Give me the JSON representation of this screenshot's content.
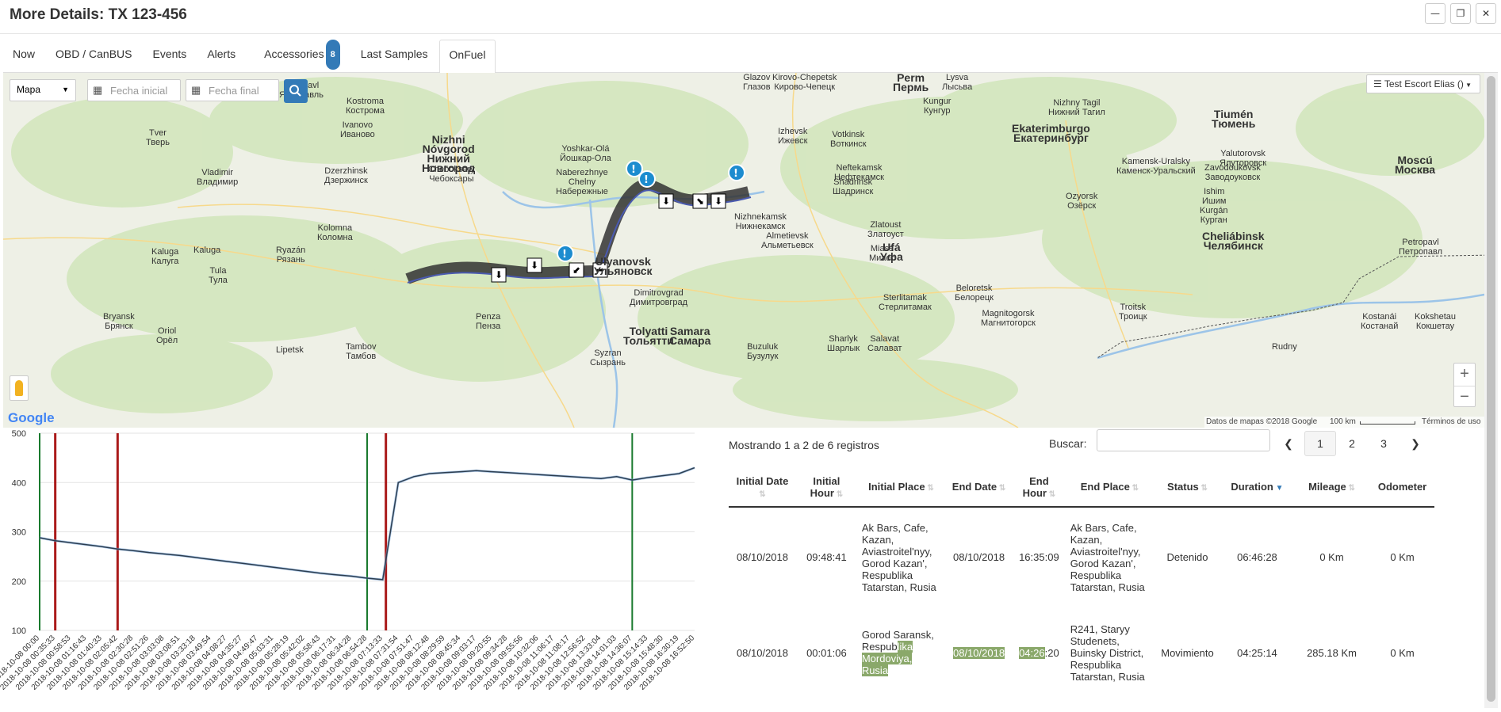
{
  "window": {
    "title": "More Details: TX 123-456",
    "minimize": "—",
    "restore": "❐",
    "close": "✕"
  },
  "tabs": [
    {
      "label": "Now"
    },
    {
      "label": "OBD / CanBUS"
    },
    {
      "label": "Events"
    },
    {
      "label": "Alerts"
    },
    {
      "label": "Accessories",
      "badge": "8"
    },
    {
      "label": "Last Samples"
    },
    {
      "label": "OnFuel",
      "active": true
    }
  ],
  "map": {
    "type_select": "Mapa",
    "date_start_placeholder": "Fecha inicial",
    "date_end_placeholder": "Fecha final",
    "layer_button": "Test Escort Elias ()",
    "zoom_in": "+",
    "zoom_out": "−",
    "attribution": "Datos de mapas ©2018 Google",
    "scale": "100 km",
    "terms": "Términos de uso",
    "google": "Google",
    "labels": [
      {
        "t": "Perm\nПермь",
        "big": true
      },
      {
        "t": "Kirovo-Chepetsk\nКирово-Чепецк"
      },
      {
        "t": "Glazov\nГлазов"
      },
      {
        "t": "Lysva\nЛысьва"
      },
      {
        "t": "Nizhny Tagil\nНижний Тагил"
      },
      {
        "t": "Yaroslavl\nЯрославль"
      },
      {
        "t": "Kostroma\nКострома"
      },
      {
        "t": "Kungur\nКунгур"
      },
      {
        "t": "Tiumén\nТюмень",
        "big": true
      },
      {
        "t": "Tver\nТверь"
      },
      {
        "t": "Ivanovo\nИваново"
      },
      {
        "t": "Nizhni\nNóvgorod\nНижний\nНовгород",
        "big": true
      },
      {
        "t": "Yoshkar-Olá\nЙошкар-Ола"
      },
      {
        "t": "Izhevsk\nИжевск"
      },
      {
        "t": "Votkinsk\nВоткинск"
      },
      {
        "t": "Ekaterimburgo\nЕкатеринбург",
        "big": true
      },
      {
        "t": "Kamensk-Uralsky\nКаменск-Уральский"
      },
      {
        "t": "Yalutorovsk\nЯлуторовск"
      },
      {
        "t": "Moscú\nМосква",
        "big": true
      },
      {
        "t": "Vladimir\nВладимир"
      },
      {
        "t": "Dzerzhinsk\nДзержинск"
      },
      {
        "t": "Cheboksary\nЧебоксары"
      },
      {
        "t": "Naberezhnye\nChelny\nНабережные"
      },
      {
        "t": "Neftekamsk\nНефтекамск"
      },
      {
        "t": "Shadrinsk\nШадринск"
      },
      {
        "t": "Zavodoukovsk\nЗаводоуковск"
      },
      {
        "t": "Ishim\nИшим"
      },
      {
        "t": "Ozyorsk\nОзёрск"
      },
      {
        "t": "Kurgán\nКурган"
      },
      {
        "t": "Nizhnekamsk\nНижнекамск"
      },
      {
        "t": "Almetievsk\nАльметьевск"
      },
      {
        "t": "Cheliábinsk\nЧелябинск",
        "big": true
      },
      {
        "t": "Zlatoust\nЗлатоуст"
      },
      {
        "t": "Kolomna\nКоломна"
      },
      {
        "t": "Ryazán\nРязань"
      },
      {
        "t": "Kaluga\nКалуга"
      },
      {
        "t": "Tula\nТула"
      },
      {
        "t": "Ulyanovsk\nУльяновск",
        "big": true
      },
      {
        "t": "Ufá\nУфа",
        "big": true
      },
      {
        "t": "Miass\nМиасс"
      },
      {
        "t": "Petropavl\nПетропавл"
      },
      {
        "t": "Dimitrovgrad\nДимитровград"
      },
      {
        "t": "Sterlitamak\nСтерлитамак"
      },
      {
        "t": "Beloretsk\nБелорецк"
      },
      {
        "t": "Troitsk\nТроицк"
      },
      {
        "t": "Magnitogorsk\nМагнитогорск"
      },
      {
        "t": "Bryansk\nБрянск"
      },
      {
        "t": "Oriol\nОрёл"
      },
      {
        "t": "Penza\nПенза"
      },
      {
        "t": "Tolyatti\nТольятти",
        "big": true
      },
      {
        "t": "Samara\nСамара",
        "big": true
      },
      {
        "t": "Kostanái\nКостанай"
      },
      {
        "t": "Kokshetau\nКокшетау"
      },
      {
        "t": "Lipetsk"
      },
      {
        "t": "Tambov\nТамбов"
      },
      {
        "t": "Syzran\nСызрань"
      },
      {
        "t": "Buzuluk\nБузулук"
      },
      {
        "t": "Sharlyk\nШарлык"
      },
      {
        "t": "Salavat\nСалават"
      },
      {
        "t": "Rudny"
      },
      {
        "t": "Kaluga"
      }
    ]
  },
  "chart_data": {
    "type": "line",
    "ylim": [
      100,
      500
    ],
    "yticks": [
      "500",
      "400",
      "300",
      "200",
      "100"
    ],
    "x": [
      "2018-10-08 00:00",
      "2018-10-08 00:35:33",
      "2018-10-08 00:58:53",
      "2018-10-08 01:16:43",
      "2018-10-08 01:40:33",
      "2018-10-08 02:05:42",
      "2018-10-08 02:30:28",
      "2018-10-08 02:51:26",
      "2018-10-08 03:03:08",
      "2018-10-08 03:08:51",
      "2018-10-08 03:33:18",
      "2018-10-08 03:49:54",
      "2018-10-08 04:08:27",
      "2018-10-08 04:35:27",
      "2018-10-08 04:49:47",
      "2018-10-08 05:03:31",
      "2018-10-08 05:28:19",
      "2018-10-08 05:42:02",
      "2018-10-08 05:58:43",
      "2018-10-08 06:17:31",
      "2018-10-08 06:34:28",
      "2018-10-08 06:54:28",
      "2018-10-08 07:13:33",
      "2018-10-08 07:31:54",
      "2018-10-08 07:51:47",
      "2018-10-08 08:12:48",
      "2018-10-08 08:29:59",
      "2018-10-08 08:45:34",
      "2018-10-08 09:03:17",
      "2018-10-08 09:20:55",
      "2018-10-08 09:34:28",
      "2018-10-08 09:55:56",
      "2018-10-08 10:32:06",
      "2018-10-08 11:06:17",
      "2018-10-08 11:08:17",
      "2018-10-08 12:56:52",
      "2018-10-08 13:33:04",
      "2018-10-08 14:01:03",
      "2018-10-08 14:36:07",
      "2018-10-08 15:14:33",
      "2018-10-08 15:48:30",
      "2018-10-08 16:30:19",
      "2018-10-08 16:52:50"
    ],
    "values": [
      288,
      282,
      278,
      274,
      270,
      265,
      262,
      258,
      255,
      252,
      248,
      244,
      240,
      236,
      232,
      228,
      224,
      220,
      216,
      213,
      210,
      206,
      203,
      400,
      412,
      418,
      420,
      422,
      424,
      422,
      420,
      418,
      416,
      414,
      412,
      410,
      408,
      412,
      405,
      410,
      414,
      418,
      430
    ],
    "markers_green_idx": [
      0,
      21,
      38
    ],
    "markers_red_idx": [
      1,
      5,
      22
    ],
    "colors": {
      "line": "#2d3e50",
      "green": "#1a7a2e",
      "red": "#aa1a1a"
    }
  },
  "table": {
    "info": "Mostrando 1 a 2 de 6 registros",
    "search_label": "Buscar:",
    "pages": [
      "1",
      "2",
      "3"
    ],
    "prev": "❮",
    "next": "❯",
    "columns": [
      "Initial Date",
      "Initial Hour",
      "Initial Place",
      "End Date",
      "End Hour",
      "End Place",
      "Status",
      "Duration",
      "Mileage",
      "Odometer"
    ],
    "rows": [
      {
        "initial_date": "08/10/2018",
        "initial_hour": "09:48:41",
        "initial_place": "Ak Bars, Cafe, Kazan, Aviastroitel'nyy, Gorod Kazan', Respublika Tatarstan, Rusia",
        "end_date": "08/10/2018",
        "end_hour": "16:35:09",
        "end_place": "Ak Bars, Cafe, Kazan, Aviastroitel'nyy, Gorod Kazan', Respublika Tatarstan, Rusia",
        "status": "Detenido",
        "duration": "06:46:28",
        "mileage": "0 Km",
        "odometer": "0 Km"
      },
      {
        "initial_date": "08/10/2018",
        "initial_hour": "00:01:06",
        "initial_place_a": "Gorod Saransk, Respub",
        "initial_place_b": "lika Mordoviya, Rusia",
        "end_date": "08/10/2018",
        "end_hour_a": "04:26",
        "end_hour_b": ":20",
        "end_place": "R241, Staryy Studenets, Buinsky District, Respublika Tatarstan, Rusia",
        "status": "Movimiento",
        "duration": "04:25:14",
        "mileage": "285.18 Km",
        "odometer": "0 Km"
      }
    ]
  }
}
